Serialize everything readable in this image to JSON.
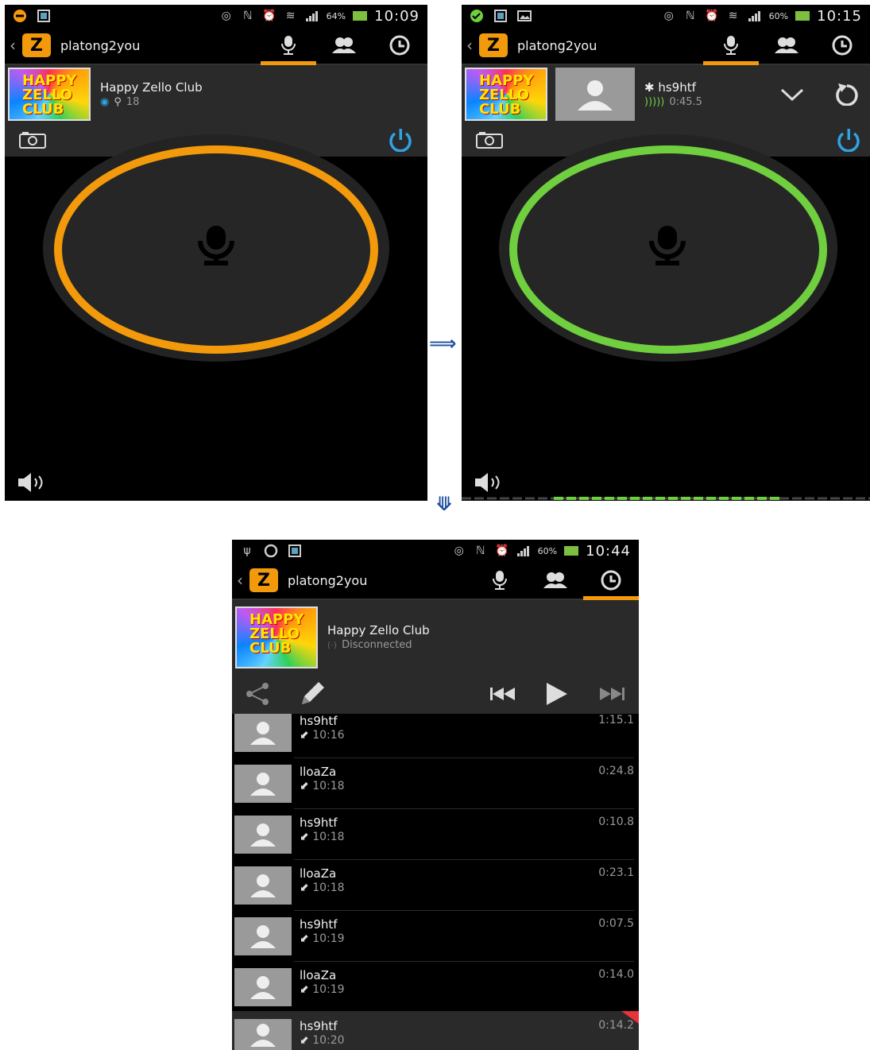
{
  "panel1": {
    "status": {
      "battery": "64%",
      "time": "10:09"
    },
    "app_name": "platong2you",
    "channel": {
      "title": "Happy Zello Club",
      "users": "18"
    }
  },
  "panel2": {
    "status": {
      "battery": "60%",
      "time": "10:15"
    },
    "app_name": "platong2you",
    "speaker": {
      "name": "hs9htf",
      "duration": "0:45.5"
    }
  },
  "panel3": {
    "status": {
      "battery": "60%",
      "time": "10:44"
    },
    "app_name": "platong2you",
    "channel": {
      "title": "Happy Zello Club",
      "status": "Disconnected"
    },
    "messages": [
      {
        "name": "hs9htf",
        "time": "10:16",
        "duration": "1:15.1"
      },
      {
        "name": "lloaZa",
        "time": "10:18",
        "duration": "0:24.8"
      },
      {
        "name": "hs9htf",
        "time": "10:18",
        "duration": "0:10.8"
      },
      {
        "name": "lloaZa",
        "time": "10:18",
        "duration": "0:23.1"
      },
      {
        "name": "hs9htf",
        "time": "10:19",
        "duration": "0:07.5"
      },
      {
        "name": "lloaZa",
        "time": "10:19",
        "duration": "0:14.0"
      },
      {
        "name": "hs9htf",
        "time": "10:20",
        "duration": "0:14.2"
      }
    ]
  },
  "logo_lines": [
    "HAPPY",
    "ZELLO",
    "CLUB"
  ],
  "colors": {
    "accent": "#f39a0c",
    "talking": "#6fcf3f",
    "power": "#2ea3e6",
    "arrow": "#1f4e9e",
    "pad": "#262626"
  }
}
